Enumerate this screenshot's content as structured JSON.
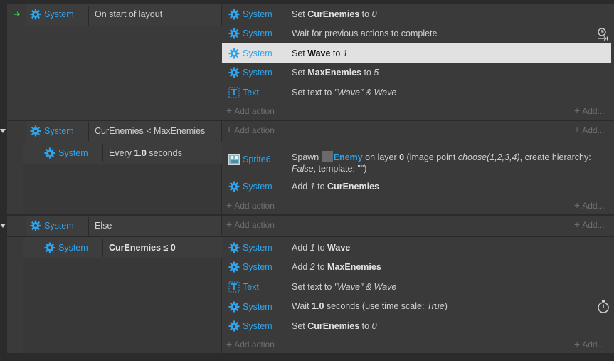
{
  "colors": {
    "accent": "#2fa4ec",
    "arrow": "#3fd34a"
  },
  "events": [
    {
      "condition": {
        "object": "System",
        "text": "On start of layout"
      },
      "actions": [
        {
          "object": "System",
          "parts": [
            "Set ",
            "CurEnemies",
            " to ",
            "0"
          ]
        },
        {
          "object": "System",
          "text": "Wait for previous actions to complete"
        },
        {
          "object": "System",
          "parts": [
            "Set ",
            "Wave",
            " to ",
            "1"
          ]
        },
        {
          "object": "System",
          "parts": [
            "Set ",
            "MaxEnemies",
            " to ",
            "5"
          ]
        },
        {
          "object": "Text",
          "parts": [
            "Set text to ",
            "\"Wave\" & Wave"
          ]
        }
      ]
    },
    {
      "condition": {
        "object": "System",
        "text": "CurEnemies < MaxEnemies"
      }
    },
    {
      "condition": {
        "object": "System",
        "parts": [
          "Every ",
          "1.0",
          " seconds"
        ]
      },
      "actions": [
        {
          "object": "Sprite6",
          "parts": [
            "Spawn ",
            "Enemy",
            " on layer ",
            "0",
            " (image point ",
            "choose(1,2,3,4)",
            ", create hierarchy:",
            "False",
            ", template: \"\")"
          ]
        },
        {
          "object": "System",
          "parts": [
            "Add ",
            "1",
            " to ",
            "CurEnemies"
          ]
        }
      ]
    },
    {
      "condition": {
        "object": "System",
        "text": "Else"
      }
    },
    {
      "condition": {
        "object": "System",
        "text": "CurEnemies ≤ 0"
      },
      "actions": [
        {
          "object": "System",
          "parts": [
            "Add ",
            "1",
            " to ",
            "Wave"
          ]
        },
        {
          "object": "System",
          "parts": [
            "Add ",
            "2",
            " to ",
            "MaxEnemies"
          ]
        },
        {
          "object": "Text",
          "parts": [
            "Set text to ",
            "\"Wave\" & Wave"
          ]
        },
        {
          "object": "System",
          "parts": [
            "Wait ",
            "1.0",
            " seconds (use time scale: ",
            "True",
            ")"
          ]
        },
        {
          "object": "System",
          "parts": [
            "Set ",
            "CurEnemies",
            " to ",
            "0"
          ]
        }
      ]
    }
  ],
  "labels": {
    "add_action": "Add action",
    "add": "Add..."
  }
}
